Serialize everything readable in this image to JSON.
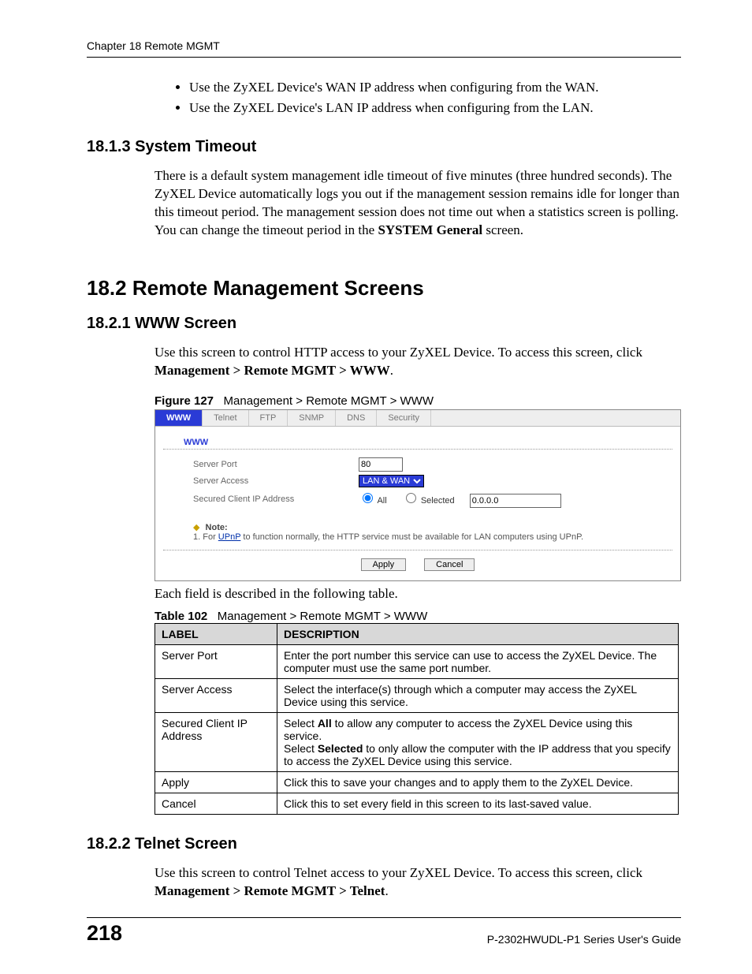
{
  "header": {
    "chapter": "Chapter 18 Remote MGMT"
  },
  "bullets": [
    "Use the ZyXEL Device's WAN IP address when configuring from the WAN.",
    "Use the ZyXEL Device's LAN IP address when configuring from the LAN."
  ],
  "s1813": {
    "heading": "18.1.3  System Timeout",
    "para_a": "There is a default system management idle timeout of five minutes (three hundred seconds). The ZyXEL Device automatically logs you out if the management session remains idle for longer than this timeout period. The management session does not time out when a statistics screen is polling. You can change the timeout period in the ",
    "para_bold": "SYSTEM General",
    "para_b": " screen."
  },
  "s182": {
    "heading": "18.2  Remote Management Screens"
  },
  "s1821": {
    "heading": "18.2.1  WWW Screen",
    "para_a": "Use this screen to control HTTP access to your ZyXEL Device. To access this screen, click ",
    "para_bold": "Management > Remote MGMT > WWW",
    "para_b": "."
  },
  "figure": {
    "label": "Figure 127",
    "caption": "Management > Remote MGMT > WWW",
    "tabs": [
      "WWW",
      "Telnet",
      "FTP",
      "SNMP",
      "DNS",
      "Security"
    ],
    "panel_title": "WWW",
    "rows": {
      "server_port_label": "Server Port",
      "server_port_value": "80",
      "server_access_label": "Server Access",
      "server_access_value": "LAN & WAN",
      "secured_label": "Secured Client IP Address",
      "radio_all": "All",
      "radio_selected": "Selected",
      "ip_value": "0.0.0.0"
    },
    "note": {
      "head": "Note:",
      "item_prefix": "1. For ",
      "upnp": "UPnP",
      "item_suffix": " to function normally, the HTTP service must be available for LAN computers using UPnP."
    },
    "buttons": {
      "apply": "Apply",
      "cancel": "Cancel"
    }
  },
  "after_figure": "Each field is described in the following table.",
  "table": {
    "label": "Table 102",
    "caption": "Management > Remote MGMT > WWW",
    "head": {
      "c1": "LABEL",
      "c2": "DESCRIPTION"
    },
    "rows": [
      {
        "label": "Server Port",
        "desc": "Enter the port number this service can use to access the ZyXEL Device. The computer must use the same port number."
      },
      {
        "label": "Server Access",
        "desc": "Select the interface(s) through which a computer may access the ZyXEL Device using this service."
      },
      {
        "label": "Secured Client IP Address",
        "desc_a1": "Select ",
        "desc_b1": "All",
        "desc_a1b": " to allow any computer to access the ZyXEL Device using this service.",
        "desc_a2": "Select ",
        "desc_b2": "Selected",
        "desc_a2b": " to only allow the computer with the IP address that you specify to access the ZyXEL Device using this service."
      },
      {
        "label": "Apply",
        "desc": "Click this to save your changes and to apply them to the ZyXEL Device."
      },
      {
        "label": "Cancel",
        "desc": "Click this to set every field in this screen to its last-saved value."
      }
    ]
  },
  "s1822": {
    "heading": "18.2.2  Telnet Screen",
    "para_a": "Use this screen to control Telnet access to your ZyXEL Device. To access this screen, click ",
    "para_bold": "Management > Remote MGMT > Telnet",
    "para_b": "."
  },
  "footer": {
    "page": "218",
    "guide": "P-2302HWUDL-P1 Series User's Guide"
  }
}
